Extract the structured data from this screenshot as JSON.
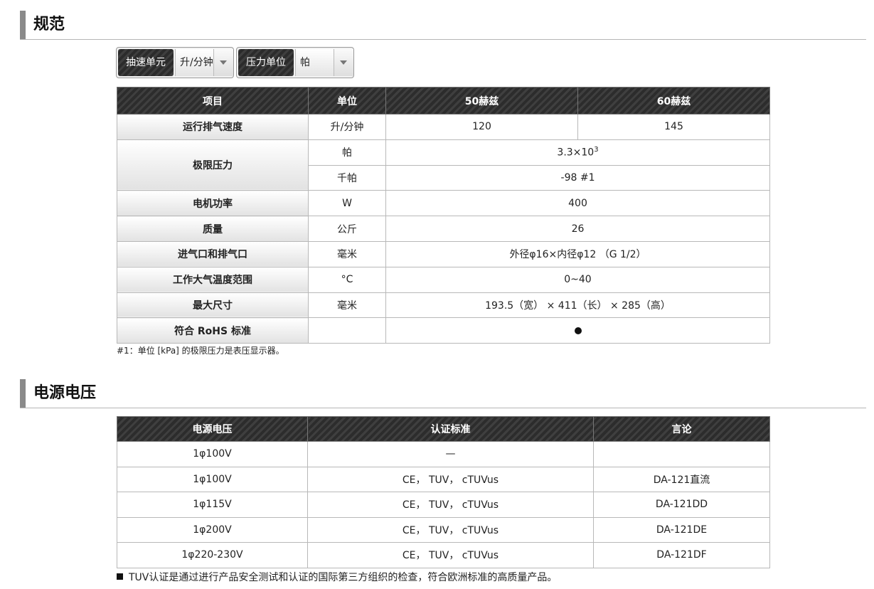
{
  "section1": {
    "title": "规范"
  },
  "selectors": {
    "pump": {
      "label": "抽速单元",
      "value": "升/分钟"
    },
    "pressure": {
      "label": "压力单位",
      "value": "帕"
    }
  },
  "spec_table": {
    "headers": [
      "项目",
      "单位",
      "50赫兹",
      "60赫兹"
    ],
    "rows": {
      "speed": {
        "item": "运行排气速度",
        "unit": "升/分钟",
        "v50": "120",
        "v60": "145"
      },
      "ultimate": {
        "item": "极限压力",
        "unit_pa": "帕",
        "value_pa_base": "3.3×10",
        "value_pa_exp": "3",
        "unit_kpa": "千帕",
        "value_kpa": "-98 #1"
      },
      "motor": {
        "item": "电机功率",
        "unit": "W",
        "value": "400"
      },
      "mass": {
        "item": "质量",
        "unit": "公斤",
        "value": "26"
      },
      "ports": {
        "item": "进气口和排气口",
        "unit": "毫米",
        "value": "外径φ16×内径φ12 （G 1/2）"
      },
      "temp": {
        "item": "工作大气温度范围",
        "unit": "°C",
        "value": "0~40"
      },
      "size": {
        "item": "最大尺寸",
        "unit": "毫米",
        "value": "193.5（宽） × 411（长） × 285（高）"
      },
      "rohs": {
        "item": "符合 RoHS 标准",
        "unit": "",
        "icon": "filled-circle-icon"
      }
    },
    "footnote": "#1：单位 [kPa] 的极限压力是表压显示器。"
  },
  "section2": {
    "title": "电源电压"
  },
  "power_table": {
    "headers": [
      "电源电压",
      "认证标准",
      "言论"
    ],
    "rows": [
      {
        "voltage": "1φ100V",
        "cert": "—",
        "remark": ""
      },
      {
        "voltage": "1φ100V",
        "cert": "CE， TUV， cTUVus",
        "remark": "DA-121直流"
      },
      {
        "voltage": "1φ115V",
        "cert": "CE， TUV， cTUVus",
        "remark": "DA-121DD"
      },
      {
        "voltage": "1φ200V",
        "cert": "CE， TUV， cTUVus",
        "remark": "DA-121DE"
      },
      {
        "voltage": "1φ220-230V",
        "cert": "CE， TUV， cTUVus",
        "remark": "DA-121DF"
      }
    ],
    "note": "TUV认证是通过进行产品安全测试和认证的国际第三方组织的检查，符合欧洲标准的高质量产品。"
  },
  "colors": {
    "header_dark": "#2c2c2c",
    "section_bar": "#8a8a8a",
    "border": "#b8b8b8"
  }
}
